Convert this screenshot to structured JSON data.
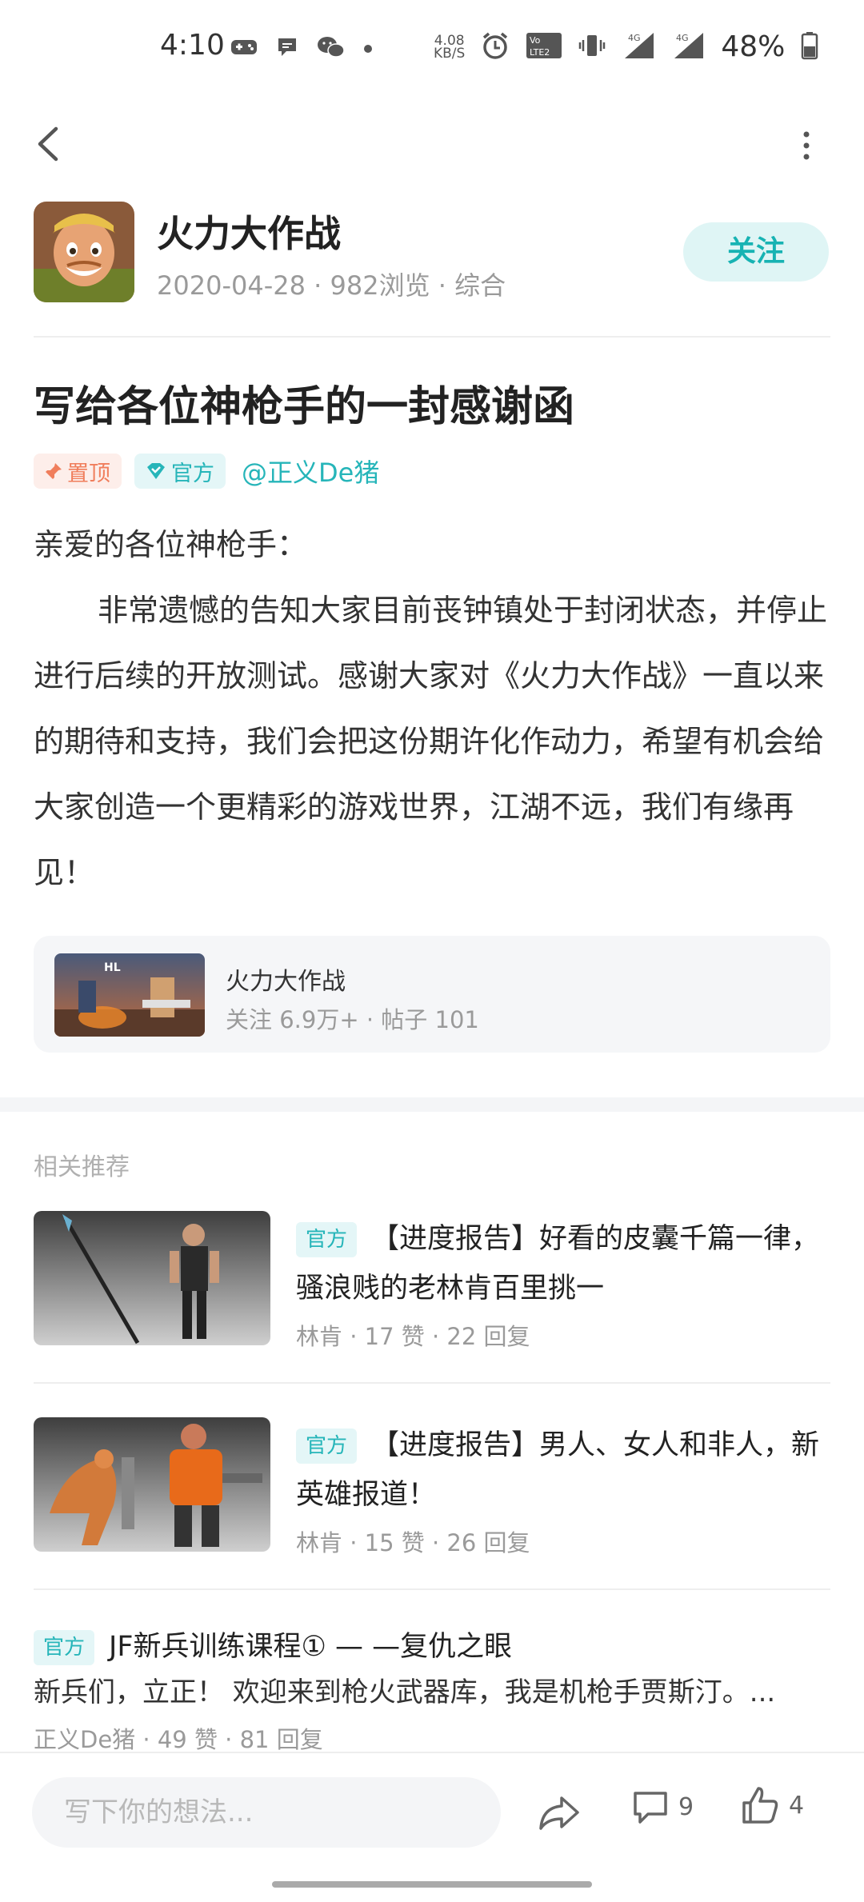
{
  "status_bar": {
    "time": "4:10",
    "net_speed": "4.08",
    "net_unit": "KB/S",
    "battery": "48%",
    "net1": "4G",
    "net2": "4G"
  },
  "post": {
    "author_name": "火力大作战",
    "date": "2020-04-28",
    "views": "982浏览",
    "category": "综合",
    "follow_label": "关注",
    "title": "写给各位神枪手的一封感谢函",
    "tag_pinned": "置顶",
    "tag_official": "官方",
    "mention": "@正义De猪",
    "greeting": "亲爱的各位神枪手：",
    "paragraph": "非常遗憾的告知大家目前丧钟镇处于封闭状态，并停止进行后续的开放测试。感谢大家对《火力大作战》一直以来的期待和支持，我们会把这份期许化作动力，希望有机会给大家创造一个更精彩的游戏世界，江湖不远，我们有缘再见！"
  },
  "game_card": {
    "name": "火力大作战",
    "meta": "关注 6.9万+ · 帖子 101"
  },
  "recommendations": {
    "header": "相关推荐",
    "items": [
      {
        "badge": "官方",
        "title": "【进度报告】好看的皮囊千篇一律，骚浪贱的老林肯百里挑一",
        "meta": "林肯 · 17 赞 · 22 回复"
      },
      {
        "badge": "官方",
        "title": "【进度报告】男人、女人和非人，新英雄报道！",
        "meta": "林肯 · 15 赞 · 26 回复"
      },
      {
        "badge": "官方",
        "title": "JF新兵训练课程① — —复仇之眼",
        "excerpt": "新兵们，立正！ 欢迎来到枪火武器库，我是机枪手贾斯汀。...",
        "meta": "正义De猪 · 49 赞 · 81 回复"
      }
    ]
  },
  "bottom_bar": {
    "input_placeholder": "写下你的想法...",
    "comment_count": "9",
    "like_count": "4"
  },
  "colors": {
    "accent": "#26b5b9",
    "follow_bg": "#dff5f5",
    "pin_color": "#f07e5c"
  }
}
